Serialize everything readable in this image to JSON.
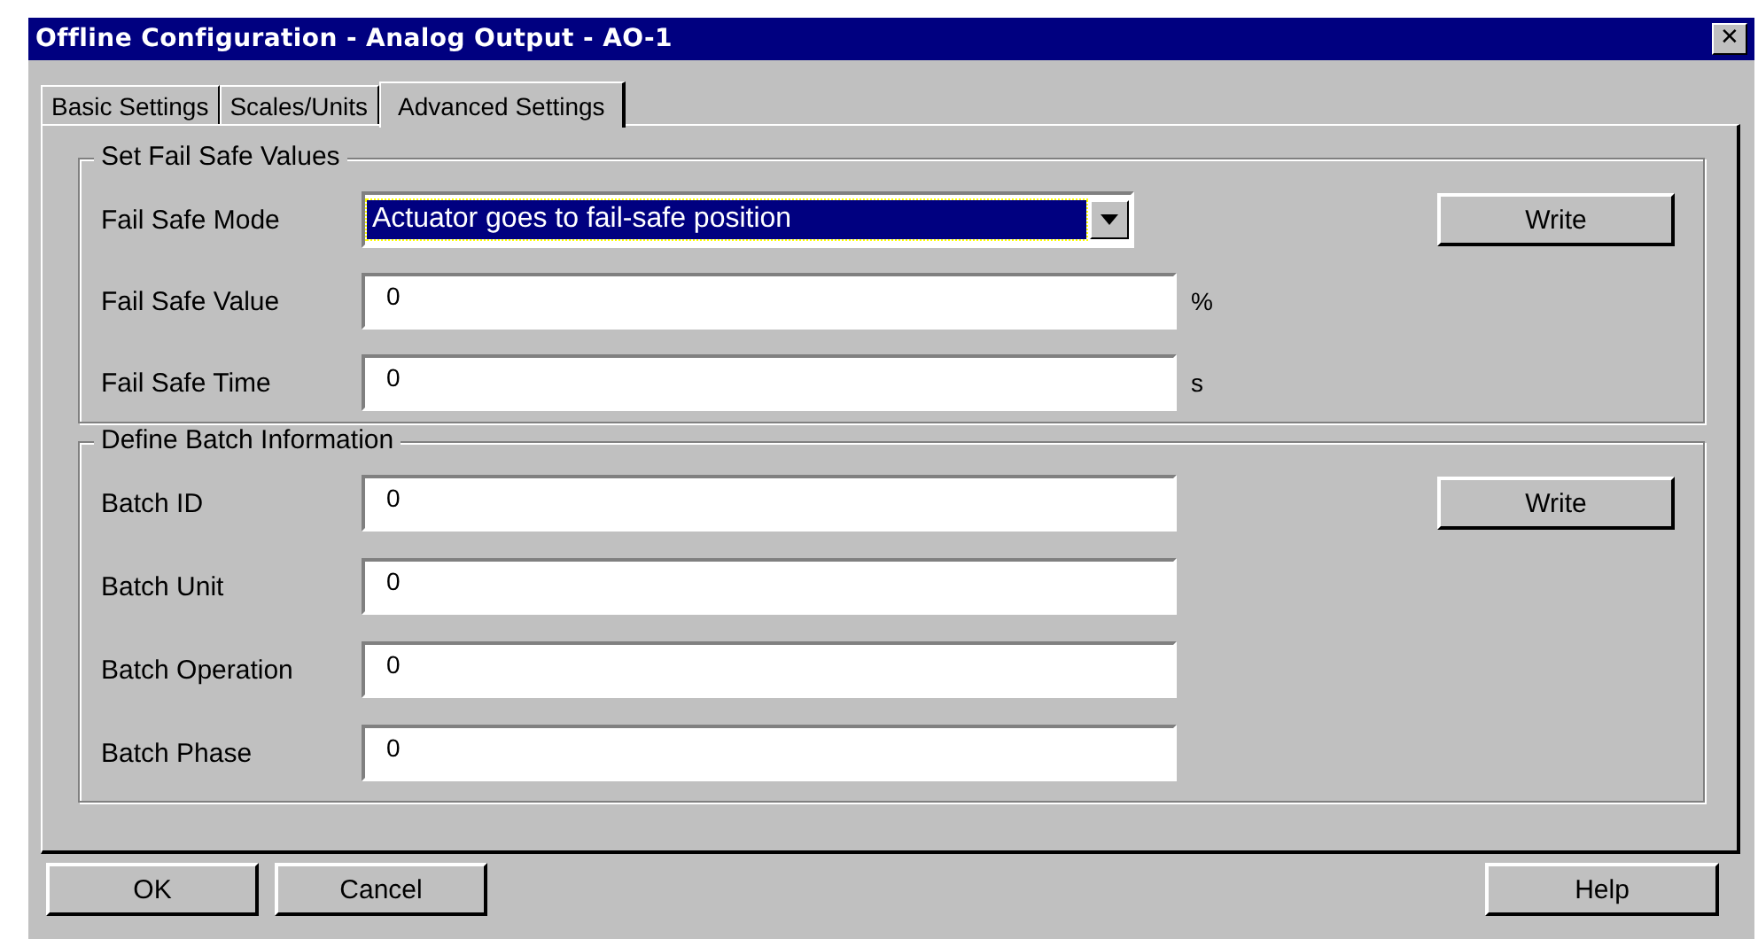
{
  "window": {
    "title": "Offline Configuration - Analog Output - AO-1",
    "close": "✕"
  },
  "tabs": [
    {
      "label": "Basic Settings",
      "selected": false
    },
    {
      "label": "Scales/Units",
      "selected": false
    },
    {
      "label": "Advanced Settings",
      "selected": true
    }
  ],
  "groups": [
    {
      "title": "Set Fail Safe Values",
      "button": "Write",
      "rows": [
        {
          "kind": "dropdown",
          "label": "Fail Safe Mode",
          "value": "Actuator goes to fail-safe position"
        },
        {
          "kind": "text",
          "label": "Fail Safe Value",
          "value": "0",
          "unit": "%"
        },
        {
          "kind": "text",
          "label": "Fail Safe Time",
          "value": "0",
          "unit": "s"
        }
      ]
    },
    {
      "title": "Define Batch Information",
      "button": "Write",
      "rows": [
        {
          "kind": "text",
          "label": "Batch ID",
          "value": "0"
        },
        {
          "kind": "text",
          "label": "Batch Unit",
          "value": "0"
        },
        {
          "kind": "text",
          "label": "Batch Operation",
          "value": "0"
        },
        {
          "kind": "text",
          "label": "Batch Phase",
          "value": "0"
        }
      ]
    }
  ],
  "buttons": {
    "left": [
      "OK",
      "Cancel"
    ],
    "right": [
      "Help"
    ]
  }
}
